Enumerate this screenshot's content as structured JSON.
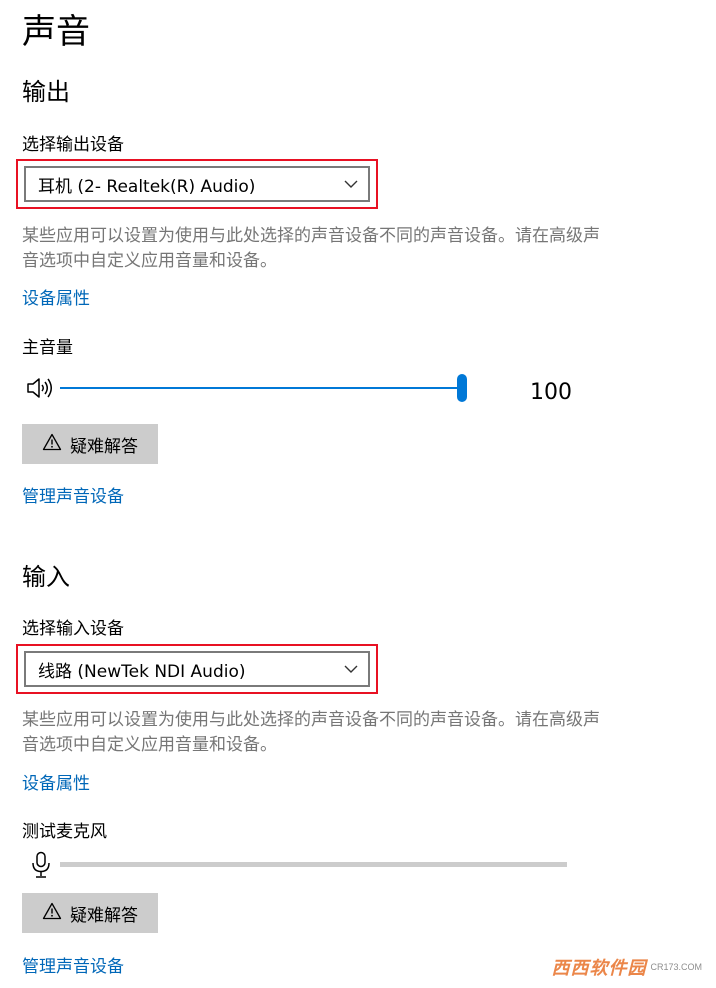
{
  "page": {
    "title": "声音"
  },
  "output": {
    "heading": "输出",
    "select_label": "选择输出设备",
    "device": "耳机 (2- Realtek(R) Audio)",
    "description": "某些应用可以设置为使用与此处选择的声音设备不同的声音设备。请在高级声音选项中自定义应用音量和设备。",
    "device_properties_link": "设备属性",
    "master_volume_label": "主音量",
    "volume_value": "100",
    "volume_level": 1.0,
    "troubleshoot_label": "疑难解答",
    "manage_devices_link": "管理声音设备"
  },
  "input": {
    "heading": "输入",
    "select_label": "选择输入设备",
    "device": "线路 (NewTek NDI Audio)",
    "description": "某些应用可以设置为使用与此处选择的声音设备不同的声音设备。请在高级声音选项中自定义应用音量和设备。",
    "device_properties_link": "设备属性",
    "test_mic_label": "测试麦克风",
    "mic_level": 0,
    "troubleshoot_label": "疑难解答",
    "manage_devices_link": "管理声音设备"
  },
  "watermark": {
    "text": "西西软件园",
    "sub": "CR173.COM"
  },
  "colors": {
    "accent": "#0067b8",
    "slider": "#0078d7",
    "highlight_frame": "#e81123",
    "button_bg": "#cccccc"
  },
  "icons": [
    "chevron-down-icon",
    "speaker-icon",
    "warning-icon",
    "microphone-icon"
  ]
}
